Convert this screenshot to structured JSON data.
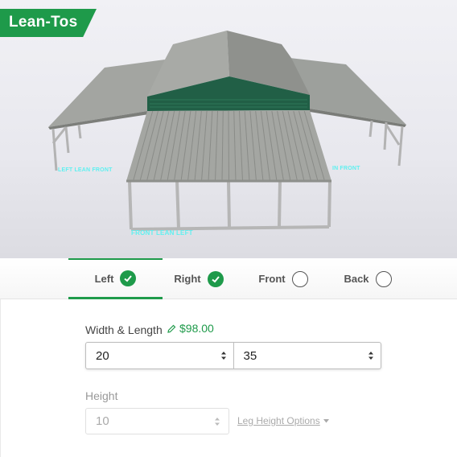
{
  "badge": {
    "title": "Lean-Tos"
  },
  "scene_labels": {
    "front": "FRONT LEAN LEFT",
    "left": "LEFT LEAN FRONT",
    "right": "IN FRONT"
  },
  "tabs": [
    {
      "label": "Left",
      "status": "checked",
      "active": true
    },
    {
      "label": "Right",
      "status": "checked",
      "active": false
    },
    {
      "label": "Front",
      "status": "unchecked",
      "active": false
    },
    {
      "label": "Back",
      "status": "unchecked",
      "active": false
    }
  ],
  "width_length": {
    "label": "Width & Length",
    "price": "$98.00",
    "width_value": "20",
    "length_value": "35"
  },
  "height": {
    "label": "Height",
    "value": "10",
    "link_label": "Leg Height Options"
  },
  "colors": {
    "accent": "#1e9a4a",
    "roof": "#9a9c98",
    "trim": "#1f5e45",
    "label_cyan": "#5ff0f0"
  }
}
